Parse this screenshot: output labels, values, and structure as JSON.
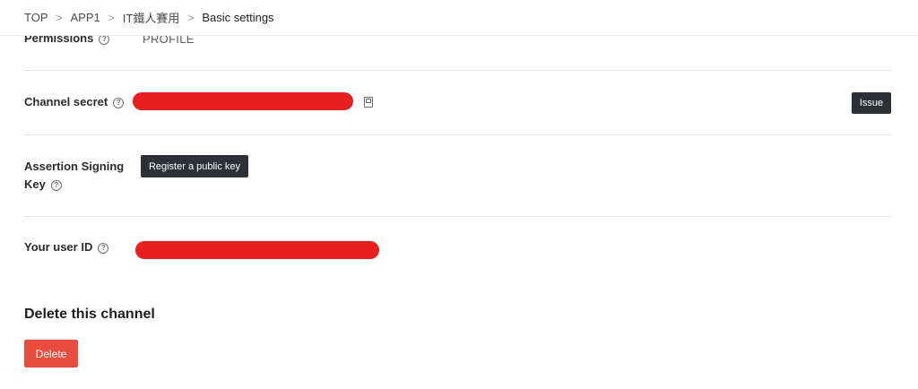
{
  "breadcrumb": {
    "items": [
      "TOP",
      "APP1",
      "IT鐵人賽用",
      "Basic settings"
    ],
    "separator": ">"
  },
  "rows": {
    "permissions": {
      "label": "Permissions",
      "value": "PROFILE"
    },
    "channel_secret": {
      "label": "Channel secret",
      "issue_label": "Issue"
    },
    "assertion_key": {
      "label_line1": "Assertion Signing",
      "label_line2": "Key",
      "register_label": "Register a public key"
    },
    "user_id": {
      "label": "Your user ID"
    }
  },
  "delete_section": {
    "title": "Delete this channel",
    "button_label": "Delete"
  },
  "icons": {
    "help": "?",
    "copy": "copy-icon"
  },
  "colors": {
    "redaction": "#e81f1f",
    "delete_button": "#e94d3d",
    "dark_button": "#2d3035"
  }
}
